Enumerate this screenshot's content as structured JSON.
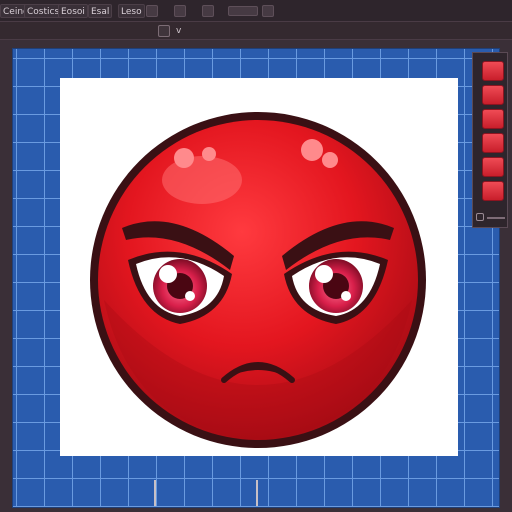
{
  "menu": {
    "items": [
      {
        "label": "Ceing"
      },
      {
        "label": "Costics"
      },
      {
        "label": "Eosoi"
      },
      {
        "label": "Esal"
      },
      {
        "label": "Leso"
      }
    ]
  },
  "toolbar2": {
    "dropdown_glyph": "v"
  },
  "canvas": {
    "background_color": "#2a5cae",
    "grid_line_color": "#6a9be0",
    "artboard_color": "#ffffff"
  },
  "artwork": {
    "subject": "angry-face-emoji",
    "face_color": "#e3161f",
    "outline_color": "#3a1014"
  },
  "layers_panel": {
    "swatch_count": 6,
    "swatch_color": "#e23440"
  },
  "icons": [
    "tool-icon",
    "square-icon",
    "gear-icon",
    "minus-icon",
    "window-icon",
    "layers-icon",
    "chevron-down-icon"
  ]
}
